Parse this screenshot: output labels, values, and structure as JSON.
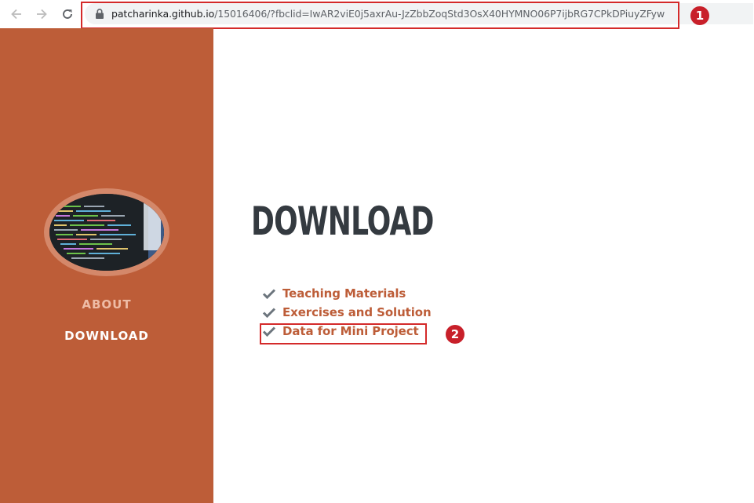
{
  "browser": {
    "url_host": "patcharinka.github.io",
    "url_path": "/15016406/?fbclid=IwAR2viE0j5axrAu-JzZbbZoqStd3OsX40HYMNO06P7ijbRG7CPkDPiuyZFyw",
    "icons": [
      "back-arrow-icon",
      "forward-arrow-icon",
      "reload-icon",
      "lock-icon"
    ]
  },
  "annotations": [
    {
      "label": "1",
      "color": "#c8202a"
    },
    {
      "label": "2",
      "color": "#c8202a"
    }
  ],
  "sidebar": {
    "background": "#bd5d38",
    "nav": [
      {
        "label": "ABOUT",
        "active": false
      },
      {
        "label": "DOWNLOAD",
        "active": true
      }
    ]
  },
  "main": {
    "title": "DOWNLOAD",
    "items": [
      {
        "label": "Teaching Materials",
        "icon": "check-icon"
      },
      {
        "label": "Exercises and Solution",
        "icon": "check-icon"
      },
      {
        "label": "Data for Mini Project",
        "icon": "check-icon"
      }
    ]
  },
  "colors": {
    "accent": "#bd5d38",
    "title": "#343a40",
    "check": "#6c757d",
    "annotation": "#d42a2a"
  }
}
